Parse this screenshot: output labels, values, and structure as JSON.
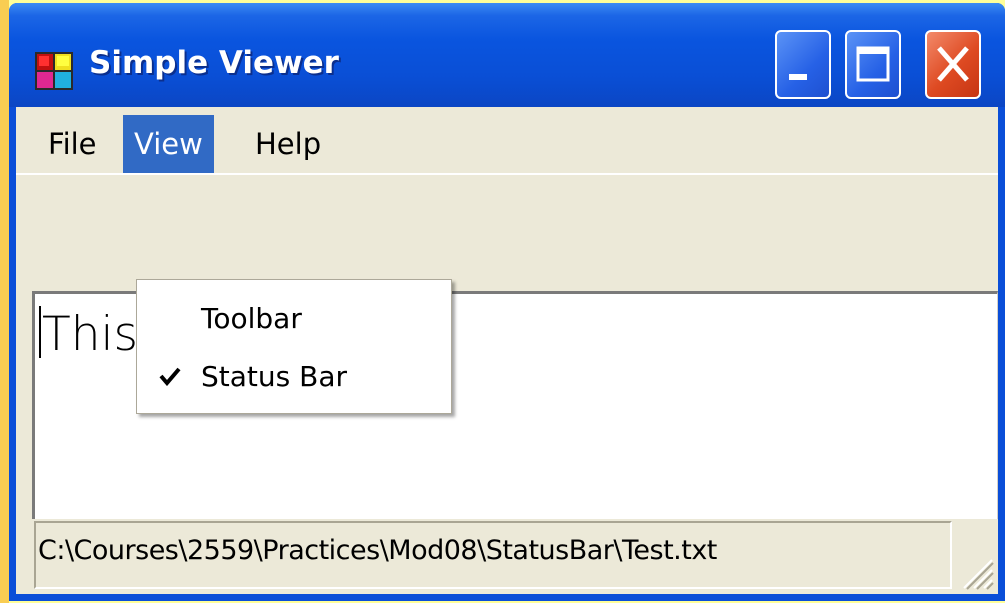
{
  "window": {
    "title": "Simple Viewer",
    "icon": "app-windows-icon",
    "controls": [
      "minimize-icon",
      "maximize-icon",
      "close-icon"
    ]
  },
  "menubar": {
    "items": [
      {
        "label": "File"
      },
      {
        "label": "View",
        "highlighted": true
      },
      {
        "label": "Help"
      }
    ]
  },
  "view_menu": {
    "items": [
      {
        "label": "Toolbar",
        "checked": false
      },
      {
        "label": "Status Bar",
        "checked": true,
        "icon": "checkmark-icon"
      }
    ]
  },
  "document": {
    "text": "This is a test..."
  },
  "statusbar": {
    "path": "C:\\Courses\\2559\\Practices\\Mod08\\StatusBar\\Test.txt"
  },
  "colors": {
    "titlebar": "#0A4FD6",
    "menu_highlight": "#316AC5",
    "close_button": "#DE4A22",
    "window_face": "#ECE9D8",
    "desktop": "#FFFF99"
  }
}
